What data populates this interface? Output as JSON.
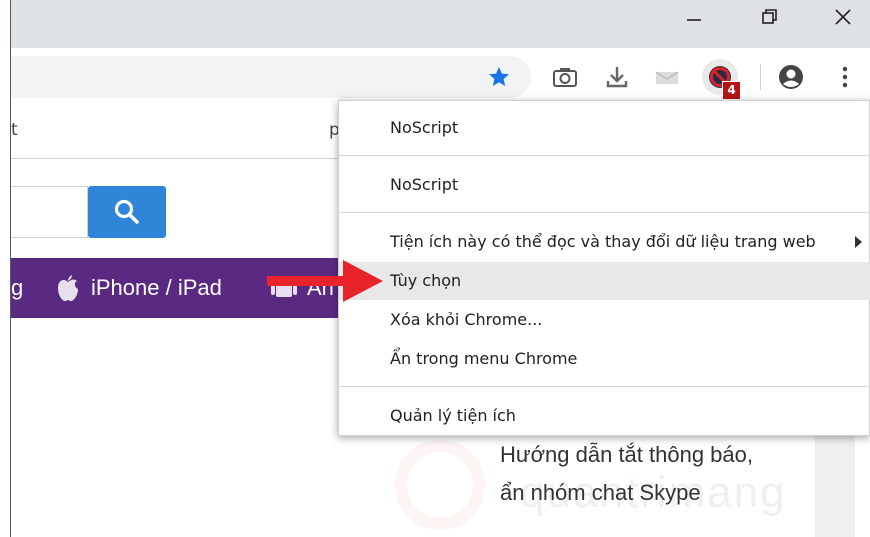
{
  "window": {
    "minimize_glyph": "—",
    "restore_glyph": "❐",
    "close_glyph": "✕"
  },
  "toolbar": {
    "icons": [
      "star-icon",
      "camera-icon",
      "download-icon",
      "mail-icon",
      "noscript-icon",
      "account-icon",
      "more-vert-icon"
    ],
    "star_color": "#1a73e8",
    "noscript_badge": "4",
    "badge_color": "#b31414"
  },
  "page": {
    "row1_left": "t",
    "row1_right": "p",
    "nav": {
      "item0": "g",
      "item1": "iPhone / iPad",
      "item2": "An"
    },
    "nav_color": "#5a2a83",
    "search_button_color": "#2f85d8",
    "article": {
      "line1": "Hướng dẫn tắt thông báo,",
      "line2": "ẩn nhóm chat Skype"
    }
  },
  "menu": {
    "items": [
      {
        "label": "NoScript"
      },
      {
        "label": "NoScript"
      },
      {
        "label": "Tiện ích này có thể đọc và thay đổi dữ liệu trang web"
      },
      {
        "label": "Tùy chọn"
      },
      {
        "label": "Xóa khỏi Chrome..."
      },
      {
        "label": "Ẩn trong menu Chrome"
      },
      {
        "label": "Quản lý tiện ích"
      }
    ],
    "highlight_color": "#e8e8e8"
  },
  "annotation": {
    "arrow_color": "#e8232a"
  }
}
